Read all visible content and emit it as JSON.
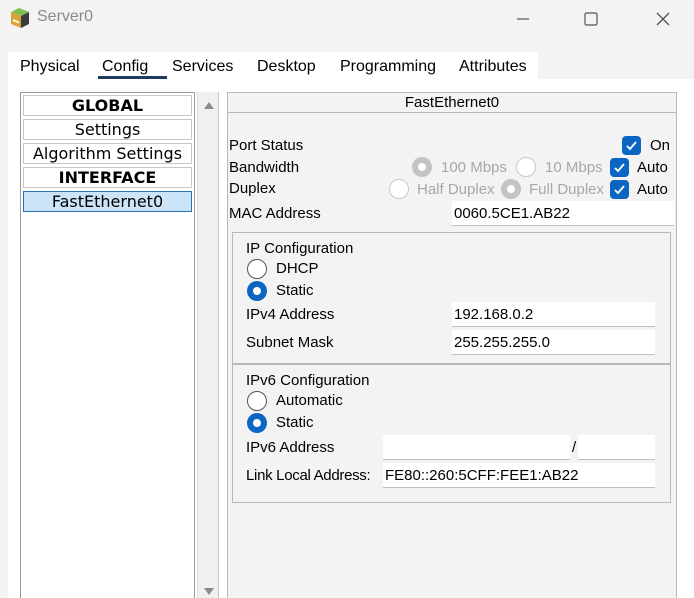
{
  "window": {
    "title": "Server0",
    "app_icon": "packet-tracer-server-icon",
    "controls": {
      "minimize_icon": "minimize-icon",
      "maximize_icon": "maximize-icon",
      "close_icon": "close-icon"
    }
  },
  "tabs": [
    {
      "label": "Physical",
      "active": false
    },
    {
      "label": "Config",
      "active": true
    },
    {
      "label": "Services",
      "active": false
    },
    {
      "label": "Desktop",
      "active": false
    },
    {
      "label": "Programming",
      "active": false
    },
    {
      "label": "Attributes",
      "active": false
    }
  ],
  "sidebar": {
    "items": [
      {
        "label": "GLOBAL",
        "type": "header"
      },
      {
        "label": "Settings",
        "type": "item"
      },
      {
        "label": "Algorithm Settings",
        "type": "item"
      },
      {
        "label": "INTERFACE",
        "type": "header"
      },
      {
        "label": "FastEthernet0",
        "type": "item",
        "selected": true
      }
    ]
  },
  "interface": {
    "title": "FastEthernet0",
    "port_status": {
      "label": "Port Status",
      "on_label": "On",
      "on": true
    },
    "bandwidth": {
      "label": "Bandwidth",
      "option_100": "100 Mbps",
      "option_10": "10 Mbps",
      "auto_label": "Auto",
      "auto": true
    },
    "duplex": {
      "label": "Duplex",
      "option_half": "Half Duplex",
      "option_full": "Full Duplex",
      "auto_label": "Auto",
      "auto": true
    },
    "mac": {
      "label": "MAC Address",
      "value": "0060.5CE1.AB22"
    },
    "ipv4": {
      "title": "IP Configuration",
      "dhcp_label": "DHCP",
      "static_label": "Static",
      "mode": "static",
      "address_label": "IPv4 Address",
      "address": "192.168.0.2",
      "mask_label": "Subnet Mask",
      "mask": "255.255.255.0"
    },
    "ipv6": {
      "title": "IPv6 Configuration",
      "automatic_label": "Automatic",
      "static_label": "Static",
      "mode": "static",
      "address_label": "IPv6 Address",
      "address": "",
      "prefix_separator": "/",
      "prefix": "",
      "link_local_label": "Link Local Address:",
      "link_local": "FE80::260:5CFF:FEE1:AB22"
    }
  },
  "colors": {
    "accent": "#0a66c2",
    "selected_bg": "#cce4f7",
    "tab_underline": "#1f3a5f"
  }
}
